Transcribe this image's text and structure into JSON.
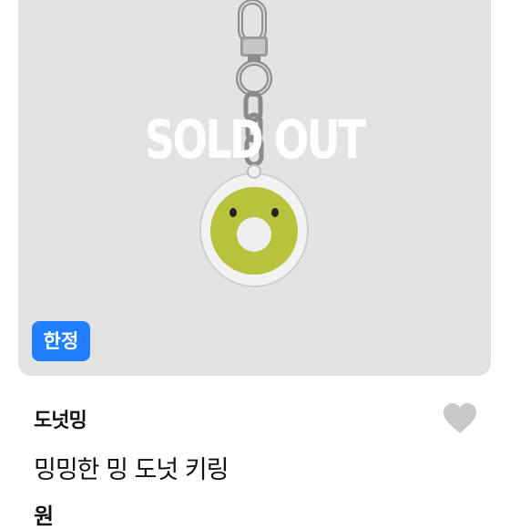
{
  "product": {
    "overlay_label": "SOLD OUT",
    "badge_label": "한정",
    "store_name": "도넛밍",
    "title": "밍밍한 밍 도넛 키링",
    "price_fragment": "원"
  },
  "colors": {
    "image_background": "#e3e3e3",
    "badge": "#1f7fff",
    "donut": "#b8c23c",
    "wishlist_heart": "#c8c8c8"
  },
  "icons": {
    "wishlist": "heart-icon"
  }
}
